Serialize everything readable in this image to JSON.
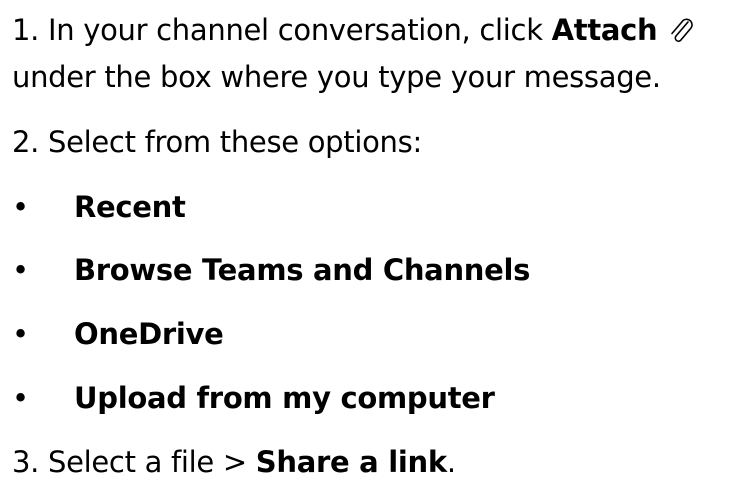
{
  "step1": {
    "prefix": "1. In your channel conversation, click ",
    "bold": "Attach",
    "icon": "paperclip-icon",
    "line2": "under the box where you type your message."
  },
  "step2": {
    "text": "2. Select from these options:"
  },
  "options": [
    {
      "bullet": "•",
      "label": "Recent"
    },
    {
      "bullet": "•",
      "label": "Browse Teams and Channels"
    },
    {
      "bullet": "•",
      "label": "OneDrive"
    },
    {
      "bullet": "•",
      "label": "Upload from my computer"
    }
  ],
  "step3": {
    "prefix": "3. Select a file > ",
    "bold": "Share a link",
    "suffix": "."
  }
}
